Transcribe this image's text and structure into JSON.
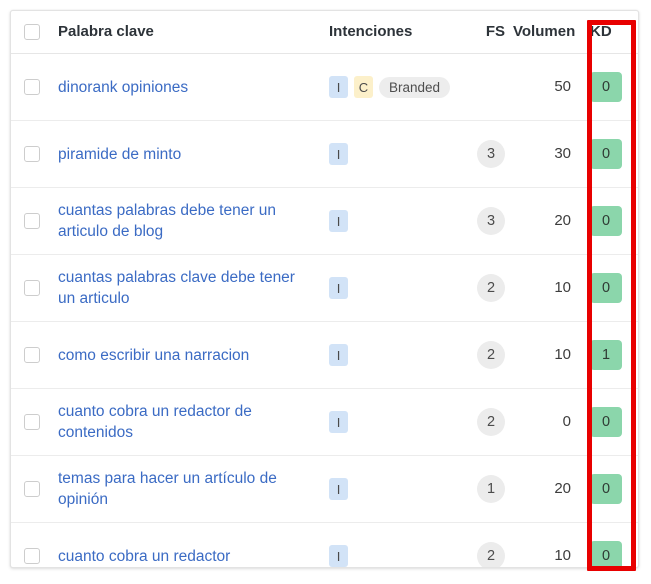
{
  "table": {
    "columns": [
      {
        "key": "select",
        "label": ""
      },
      {
        "key": "keyword",
        "label": "Palabra clave"
      },
      {
        "key": "intent",
        "label": "Intenciones"
      },
      {
        "key": "fs",
        "label": "FS"
      },
      {
        "key": "volume",
        "label": "Volumen"
      },
      {
        "key": "kd",
        "label": "KD"
      }
    ],
    "rows": [
      {
        "keyword": "dinorank opiniones",
        "intents": [
          {
            "code": "I",
            "type": "informational"
          },
          {
            "code": "C",
            "type": "commercial"
          },
          {
            "code": "Branded",
            "type": "pill"
          }
        ],
        "fs": "",
        "volume": "50",
        "kd": "0"
      },
      {
        "keyword": "piramide de minto",
        "intents": [
          {
            "code": "I",
            "type": "informational"
          }
        ],
        "fs": "3",
        "volume": "30",
        "kd": "0"
      },
      {
        "keyword": "cuantas palabras debe tener un articulo de blog",
        "intents": [
          {
            "code": "I",
            "type": "informational"
          }
        ],
        "fs": "3",
        "volume": "20",
        "kd": "0"
      },
      {
        "keyword": "cuantas palabras clave debe tener un articulo",
        "intents": [
          {
            "code": "I",
            "type": "informational"
          }
        ],
        "fs": "2",
        "volume": "10",
        "kd": "0"
      },
      {
        "keyword": "como escribir una narracion",
        "intents": [
          {
            "code": "I",
            "type": "informational"
          }
        ],
        "fs": "2",
        "volume": "10",
        "kd": "1"
      },
      {
        "keyword": "cuanto cobra un redactor de contenidos",
        "intents": [
          {
            "code": "I",
            "type": "informational"
          }
        ],
        "fs": "2",
        "volume": "0",
        "kd": "0"
      },
      {
        "keyword": "temas para hacer un artículo de opinión",
        "intents": [
          {
            "code": "I",
            "type": "informational"
          }
        ],
        "fs": "1",
        "volume": "20",
        "kd": "0"
      },
      {
        "keyword": "cuanto cobra un redactor",
        "intents": [
          {
            "code": "I",
            "type": "informational"
          }
        ],
        "fs": "2",
        "volume": "10",
        "kd": "0"
      }
    ]
  },
  "annotation": {
    "target_column": "KD",
    "color": "#e80000"
  },
  "colors": {
    "link": "#3b6bc4",
    "kd_badge_bg": "#8bd6ab",
    "intent_informational_bg": "#d2e3f7",
    "intent_commercial_bg": "#fcf0ca",
    "intent_pill_bg": "#ededed",
    "fs_circle_bg": "#ececec"
  }
}
